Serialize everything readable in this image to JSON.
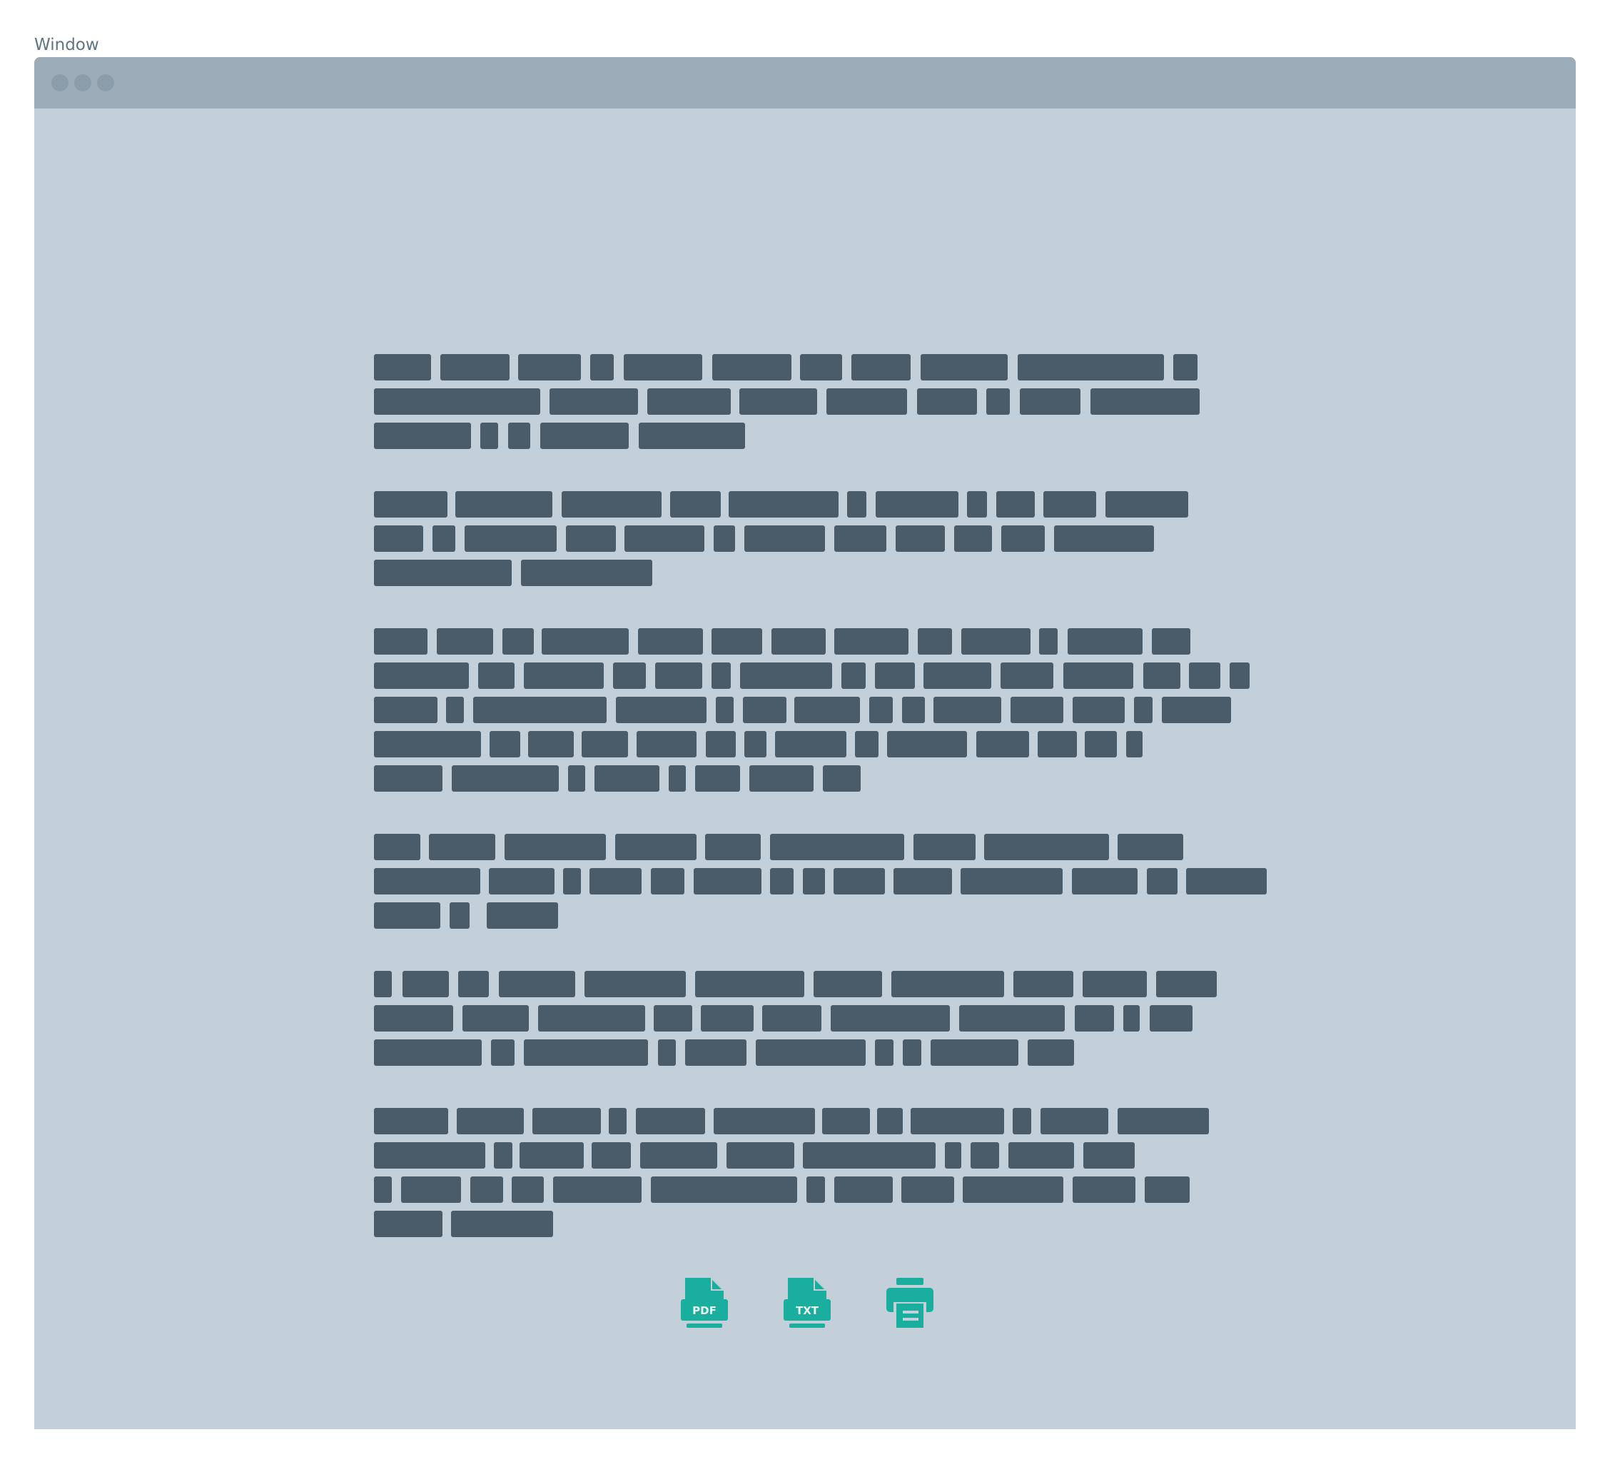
{
  "window": {
    "label": "Window"
  },
  "colors": {
    "titlebar": "#9cacb9",
    "window_bg": "#c3d0d9",
    "text_block": "#4a5b6a",
    "icon_accent": "#1aae9f"
  },
  "export_icons": [
    {
      "name": "pdf-icon",
      "text": "PDF"
    },
    {
      "name": "txt-icon",
      "text": "TXT"
    },
    {
      "name": "print-icon"
    }
  ]
}
